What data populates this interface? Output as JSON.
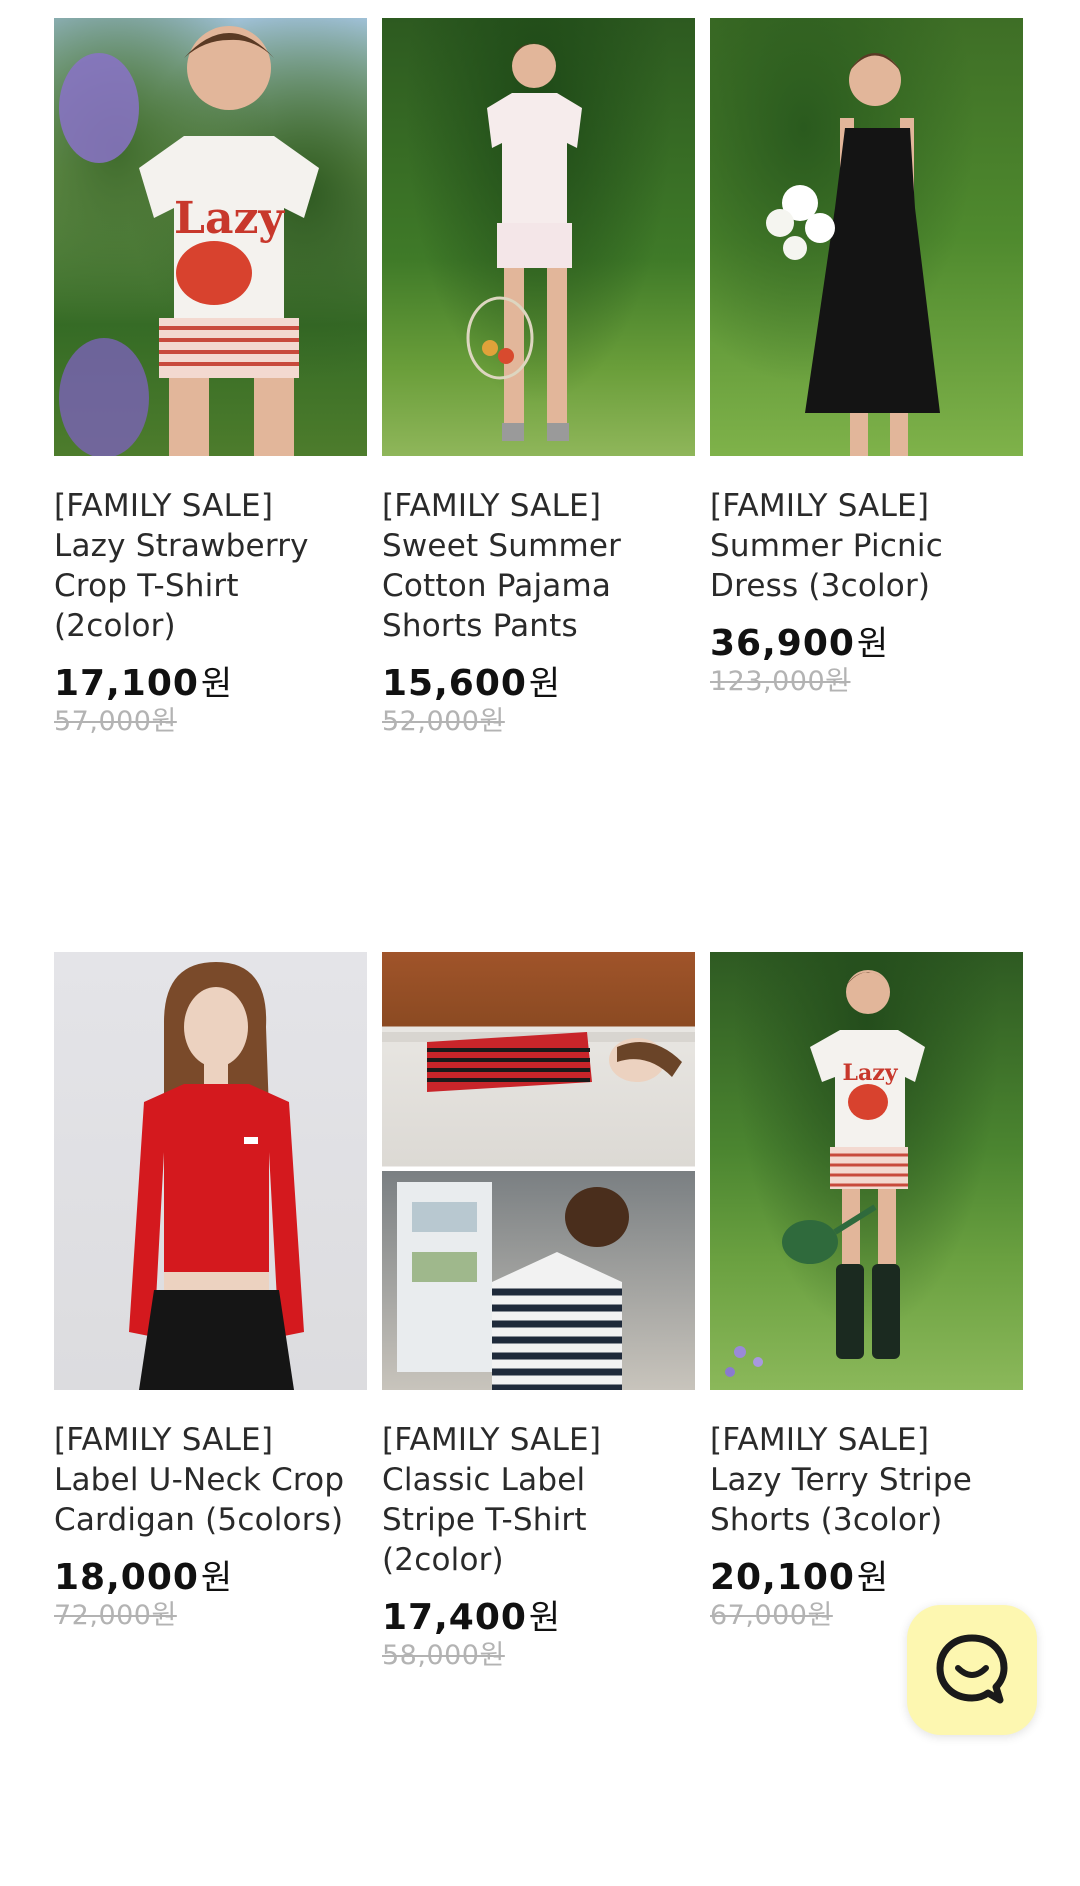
{
  "products": [
    {
      "title_lines": [
        "[FAMILY SALE]",
        "Lazy Strawberry",
        "Crop T-Shirt",
        "(2color)"
      ],
      "price": "17,100",
      "currency": "원",
      "original_price": "57,000원",
      "photo_icon": "photo-strawberry-tshirt"
    },
    {
      "title_lines": [
        "[FAMILY SALE]",
        "Sweet Summer",
        "Cotton Pajama",
        "Shorts Pants"
      ],
      "price": "15,600",
      "currency": "원",
      "original_price": "52,000원",
      "photo_icon": "photo-pajama-shorts"
    },
    {
      "title_lines": [
        "[FAMILY SALE]",
        "Summer Picnic",
        "Dress (3color)"
      ],
      "price": "36,900",
      "currency": "원",
      "original_price": "123,000원",
      "photo_icon": "photo-picnic-dress"
    },
    {
      "title_lines": [
        "[FAMILY SALE]",
        "Label U-Neck Crop",
        "Cardigan (5colors)"
      ],
      "price": "18,000",
      "currency": "원",
      "original_price": "72,000원",
      "photo_icon": "photo-crop-cardigan"
    },
    {
      "title_lines": [
        "[FAMILY SALE]",
        "Classic Label",
        "Stripe T-Shirt",
        "(2color)"
      ],
      "price": "17,400",
      "currency": "원",
      "original_price": "58,000원",
      "photo_icon": "photo-stripe-tshirt"
    },
    {
      "title_lines": [
        "[FAMILY SALE]",
        "Lazy Terry Stripe",
        "Shorts (3color)"
      ],
      "price": "20,100",
      "currency": "원",
      "original_price": "67,000원",
      "photo_icon": "photo-terry-shorts"
    }
  ],
  "photo_labels": {
    "tshirt_print": "Lazy"
  },
  "chat": {
    "icon": "chat-smile-icon"
  },
  "colors": {
    "price": "#111111",
    "original_price": "#b3b3b3",
    "chat_bg": "#fdf7b0",
    "chat_icon": "#1a1a1a"
  }
}
